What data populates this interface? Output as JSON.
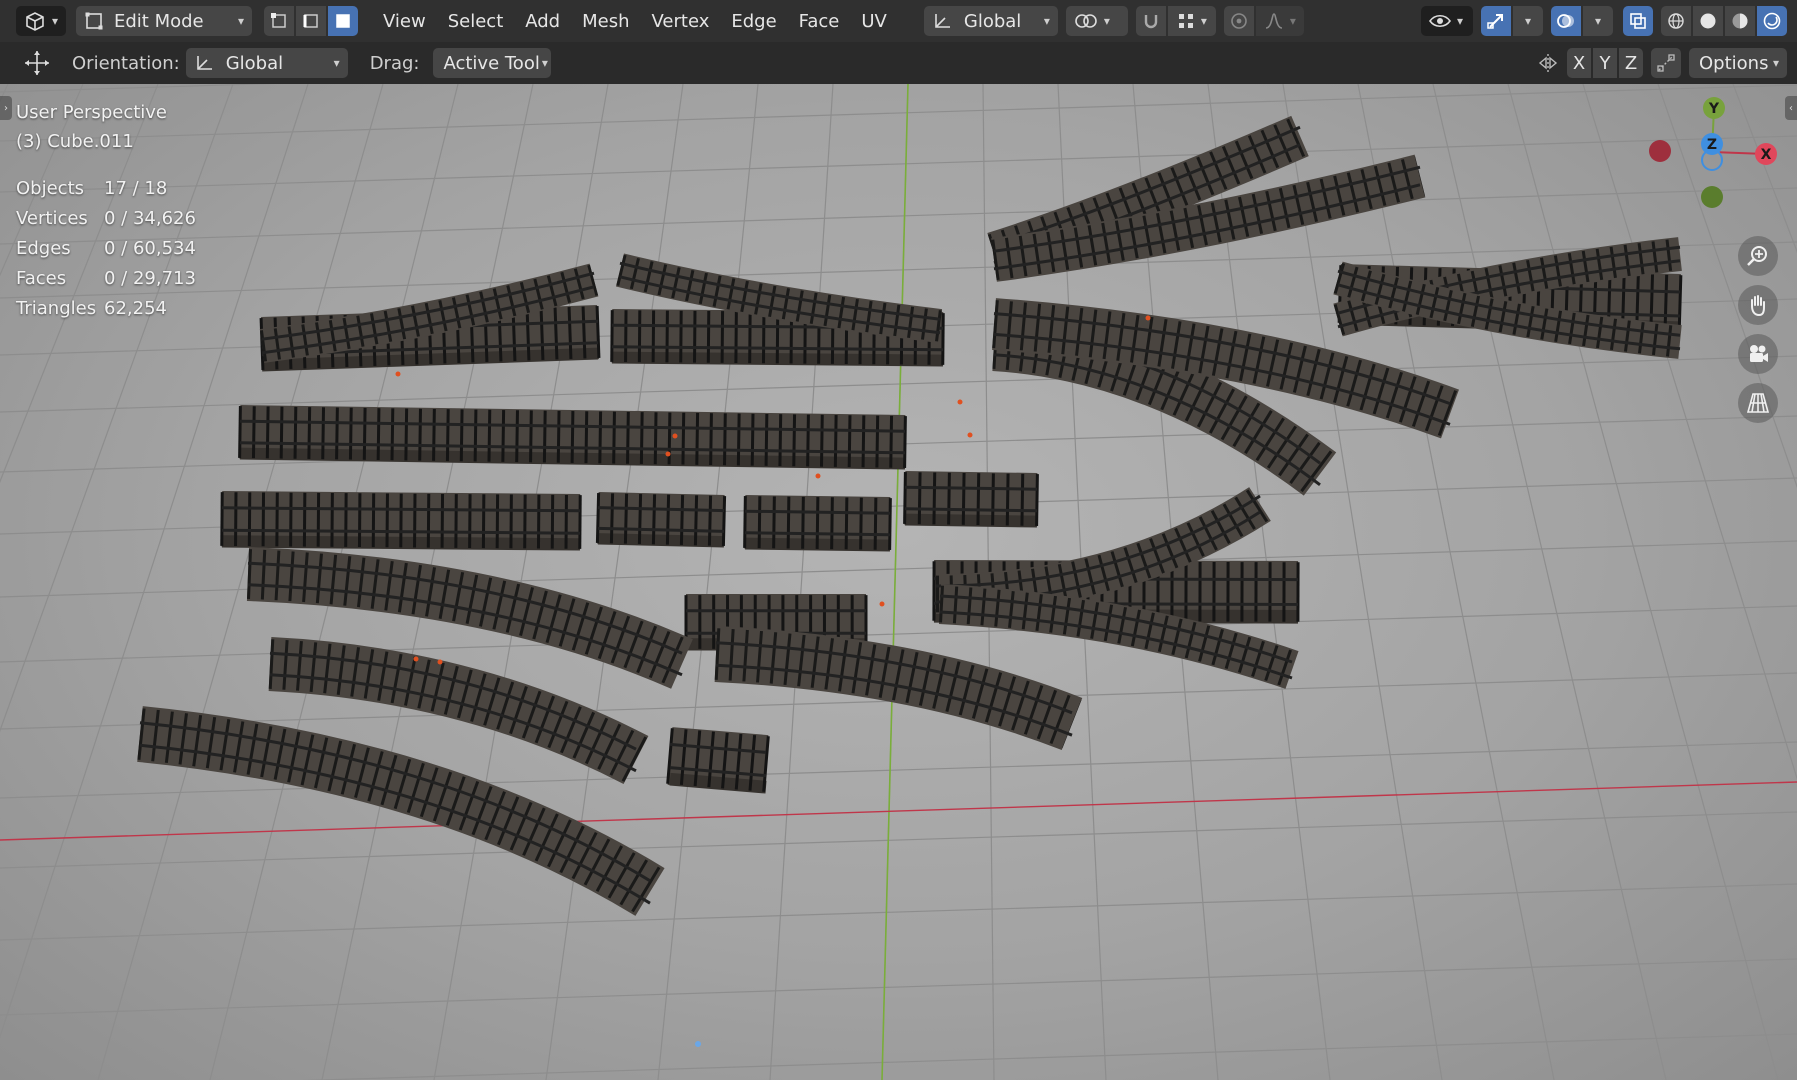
{
  "header": {
    "mode_label": "Edit Mode",
    "menus": [
      "View",
      "Select",
      "Add",
      "Mesh",
      "Vertex",
      "Edge",
      "Face",
      "UV"
    ],
    "transform_orientation": "Global",
    "select_mode_active": "face"
  },
  "toolbar": {
    "orientation_label": "Orientation:",
    "orientation_value": "Global",
    "drag_label": "Drag:",
    "drag_value": "Active Tool",
    "axes": [
      "X",
      "Y",
      "Z"
    ],
    "options_label": "Options"
  },
  "viewport": {
    "view_name": "User Perspective",
    "object_name": "(3) Cube.011",
    "stats": [
      {
        "label": "Objects",
        "value": "17 / 18"
      },
      {
        "label": "Vertices",
        "value": "0 / 34,626"
      },
      {
        "label": "Edges",
        "value": "0 / 60,534"
      },
      {
        "label": "Faces",
        "value": "0 / 29,713"
      },
      {
        "label": "Triangles",
        "value": "62,254"
      }
    ],
    "gizmo_axes": [
      "Y",
      "Z",
      "X"
    ],
    "nav_buttons": [
      "zoom-icon",
      "pan-hand-icon",
      "camera-icon",
      "grid-perspective-icon"
    ]
  },
  "colors": {
    "accent": "#4772b3",
    "axis_x": "#c0364a",
    "axis_y": "#78a23c",
    "axis_z": "#3f8fe0",
    "header_bg": "#303030",
    "track_fill": "#4a4540"
  }
}
